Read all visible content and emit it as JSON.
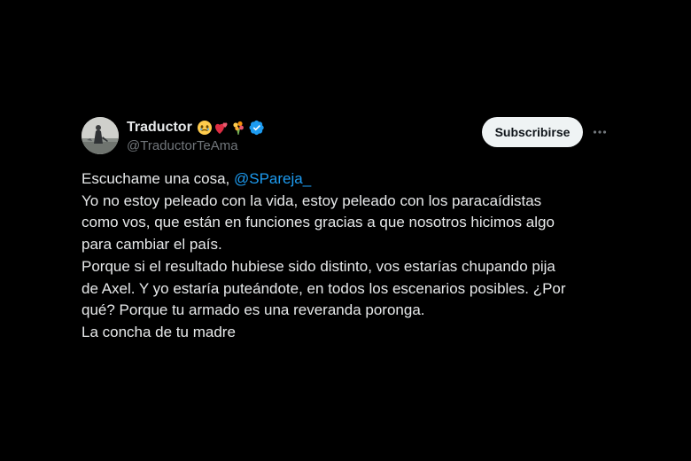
{
  "author": {
    "display_name": "Traductor",
    "handle": "@TraductorTeAma",
    "emojis": [
      "face-holding-back-tears-emoji",
      "two-hearts-emoji",
      "bouquet-emoji"
    ],
    "verified": true,
    "verified_color": "#1d9bf0"
  },
  "actions": {
    "subscribe_label": "Subscribirse",
    "more_icon": "more-horizontal-icon"
  },
  "tweet": {
    "mention": "@SPareja_",
    "lines": {
      "l1_prefix": "Escuchame una cosa, ",
      "l2": "Yo no estoy peleado con la vida, estoy peleado con los paracaídistas",
      "l3": "como vos, que están en funciones gracias a que nosotros hicimos algo",
      "l4": "para cambiar el país.",
      "l5": "Porque si el resultado hubiese sido distinto, vos estarías chupando pija",
      "l6": "de Axel. Y yo estaría puteándote, en todos los escenarios posibles. ¿Por",
      "l7": "qué? Porque tu armado es una reveranda poronga.",
      "l8": "La concha de tu madre"
    }
  },
  "colors": {
    "background": "#000000",
    "text": "#e7e9ea",
    "secondary_text": "#71767b",
    "link": "#1d9bf0",
    "button_bg": "#eff3f4"
  }
}
